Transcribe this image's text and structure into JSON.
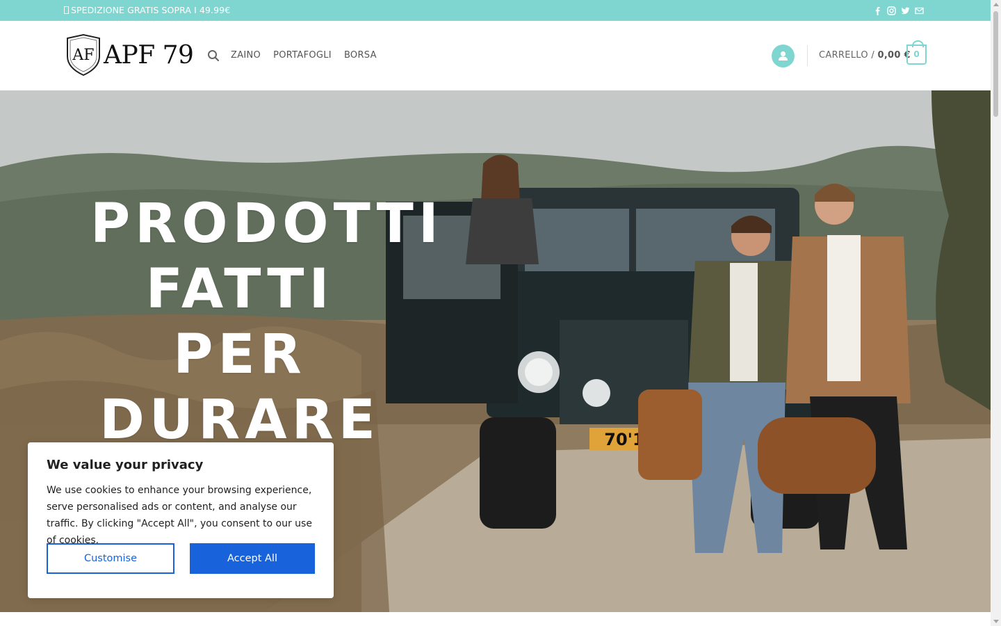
{
  "topbar": {
    "message": "SPEDIZIONE GRATIS SOPRA I 49.99€",
    "social_icons": [
      "facebook-icon",
      "instagram-icon",
      "twitter-icon",
      "mail-icon"
    ],
    "bg_color": "#7fd6d0"
  },
  "header": {
    "logo_text": "APF 79",
    "logo_badge": "AF",
    "nav": [
      "ZAINO",
      "PORTAFOGLI",
      "BORSA"
    ],
    "cart_label": "CARRELLO /",
    "cart_total": "0,00 €",
    "cart_count": "0",
    "accent_color": "#7fd6d0"
  },
  "hero": {
    "lines": [
      "PRODOTTI",
      "FATTI",
      "PER",
      "DURARE"
    ],
    "plate": "70'1"
  },
  "cookie": {
    "title": "We value your privacy",
    "body": "We use cookies to enhance your browsing experience, serve personalised ads or content, and analyse our traffic. By clicking \"Accept All\", you consent to our use of cookies.",
    "customise_label": "Customise",
    "accept_label": "Accept All",
    "button_color": "#1863dc"
  }
}
